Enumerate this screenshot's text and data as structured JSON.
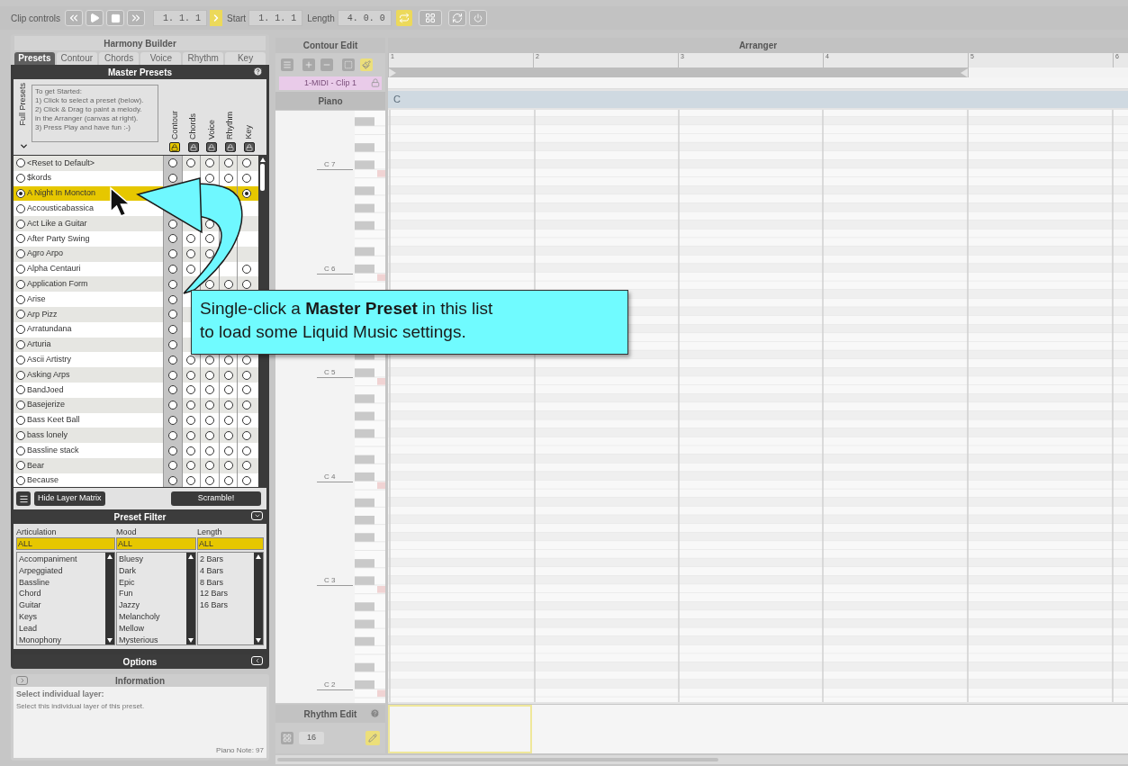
{
  "toolbar": {
    "label": "Clip controls",
    "position": "1. 1. 1",
    "follow_on": true,
    "start_label": "Start",
    "start": "1. 1. 1",
    "length_label": "Length",
    "length": "4. 0. 0",
    "loop_on": true
  },
  "harmony_builder": {
    "title": "Harmony Builder",
    "tabs": [
      {
        "label": "Presets",
        "selected": true
      },
      {
        "label": "Contour",
        "selected": false
      },
      {
        "label": "Chords",
        "selected": false
      },
      {
        "label": "Voice",
        "selected": false
      },
      {
        "label": "Rhythm",
        "selected": false
      },
      {
        "label": "Key",
        "selected": false
      }
    ],
    "master_presets": {
      "title": "Master Presets",
      "side_label": "Full Presets",
      "instructions": [
        "To get Started:",
        "1) Click to select a preset (below).",
        "2) Click & Drag to paint a melody.",
        "in the Arranger (canvas at right).",
        "3) Press Play and have fun :-)"
      ],
      "layer_columns": [
        {
          "label": "Contour",
          "locked": true
        },
        {
          "label": "Chords",
          "locked": false
        },
        {
          "label": "Voice",
          "locked": false
        },
        {
          "label": "Rhythm",
          "locked": false
        },
        {
          "label": "Key",
          "locked": false
        }
      ],
      "presets": [
        {
          "name": "<Reset to Default>",
          "selected": false,
          "layers": {
            "contour": false,
            "chords": false,
            "voice": false,
            "rhythm": false,
            "key": false
          }
        },
        {
          "name": "$kords",
          "selected": false,
          "layers": {
            "contour": false,
            "voice": false,
            "rhythm": false,
            "key": false
          }
        },
        {
          "name": "A Night In Moncton",
          "selected": true,
          "layers": {
            "key": true
          }
        },
        {
          "name": "Accousticabassica",
          "selected": false
        },
        {
          "name": "Act Like a Guitar",
          "selected": false,
          "layers": {
            "contour": false,
            "voice": false
          }
        },
        {
          "name": "After Party Swing",
          "selected": false,
          "layers": {
            "contour": false,
            "chords": false,
            "voice": false
          }
        },
        {
          "name": "Agro Arpo",
          "selected": false,
          "layers": {
            "contour": false,
            "chords": false,
            "voice": false
          }
        },
        {
          "name": "Alpha Centauri",
          "selected": false,
          "layers": {
            "contour": false,
            "chords": false,
            "key": false
          }
        },
        {
          "name": "Application Form",
          "selected": false,
          "layers": {
            "contour": false,
            "voice": false,
            "rhythm": false,
            "key": false
          }
        },
        {
          "name": "Arise",
          "selected": false,
          "layers": {
            "contour": false
          }
        },
        {
          "name": "Arp Pizz",
          "selected": false,
          "layers": {
            "contour": false
          }
        },
        {
          "name": "Arratundana",
          "selected": false,
          "layers": {
            "contour": false
          }
        },
        {
          "name": "Arturia",
          "selected": false,
          "layers": {
            "contour": false
          }
        },
        {
          "name": "Ascii Artistry",
          "selected": false,
          "layers": {
            "contour": false,
            "chords": false,
            "voice": false,
            "rhythm": false,
            "key": false
          }
        },
        {
          "name": "Asking Arps",
          "selected": false,
          "layers": {
            "contour": false,
            "chords": false,
            "voice": false,
            "rhythm": false,
            "key": false
          }
        },
        {
          "name": "BandJoed",
          "selected": false,
          "layers": {
            "contour": false,
            "chords": false,
            "voice": false,
            "rhythm": false,
            "key": false
          }
        },
        {
          "name": "Basejerize",
          "selected": false,
          "layers": {
            "contour": false,
            "chords": false,
            "voice": false,
            "rhythm": false,
            "key": false
          }
        },
        {
          "name": "Bass Keet Ball",
          "selected": false,
          "layers": {
            "contour": false,
            "chords": false,
            "voice": false,
            "rhythm": false,
            "key": false
          }
        },
        {
          "name": "bass lonely",
          "selected": false,
          "layers": {
            "contour": false,
            "chords": false,
            "voice": false,
            "rhythm": false,
            "key": false
          }
        },
        {
          "name": "Bassline stack",
          "selected": false,
          "layers": {
            "contour": false,
            "chords": false,
            "voice": false,
            "rhythm": false,
            "key": false
          }
        },
        {
          "name": "Bear",
          "selected": false,
          "layers": {
            "contour": false,
            "chords": false,
            "voice": false,
            "rhythm": false,
            "key": false
          }
        },
        {
          "name": "Because",
          "selected": false,
          "layers": {
            "contour": false,
            "chords": false,
            "voice": false,
            "rhythm": false,
            "key": false
          }
        }
      ]
    },
    "buttons": {
      "hide_layer_matrix": "Hide Layer Matrix",
      "scramble": "Scramble!"
    },
    "preset_filter": {
      "title": "Preset Filter",
      "columns": [
        {
          "label": "Articulation",
          "value": "ALL",
          "items": [
            "Accompaniment",
            "Arpeggiated",
            "Bassline",
            "Chord",
            "Guitar",
            "Keys",
            "Lead",
            "Monophony"
          ]
        },
        {
          "label": "Mood",
          "value": "ALL",
          "items": [
            "Bluesy",
            "Dark",
            "Epic",
            "Fun",
            "Jazzy",
            "Melancholy",
            "Mellow",
            "Mysterious"
          ]
        },
        {
          "label": "Length",
          "value": "ALL",
          "items": [
            "2 Bars",
            "4 Bars",
            "8 Bars",
            "12 Bars",
            "16 Bars"
          ]
        }
      ]
    },
    "options": {
      "title": "Options"
    }
  },
  "information": {
    "title": "Information",
    "heading": "Select individual layer:",
    "text": "Select this individual layer of this preset.",
    "piano_note": "Piano Note: 97"
  },
  "contour_edit": {
    "title": "Contour Edit",
    "clip": "1-MIDI - Clip 1",
    "instrument": "Piano",
    "octave_labels": [
      "C 7",
      "C 6",
      "C 5",
      "C 4",
      "C 3",
      "C 2"
    ]
  },
  "rhythm_edit": {
    "title": "Rhythm Edit",
    "steps": "16"
  },
  "arranger": {
    "title": "Arranger",
    "bars": [
      "1",
      "2",
      "3",
      "4",
      "5",
      "6"
    ],
    "chord": "C"
  },
  "callout": {
    "lines": [
      "Single-click a **Master Preset** in this list",
      "to load some Liquid Music settings."
    ]
  }
}
